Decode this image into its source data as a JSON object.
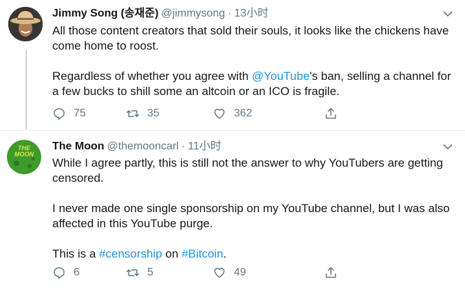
{
  "tweets": [
    {
      "author_name": "Jimmy Song (송재준)",
      "handle": "@jimmysong",
      "separator": "·",
      "time": "13小时",
      "text_p1": "All those content creators that sold their souls, it looks like the chickens have come home to roost.",
      "text_p2_before": "Regardless of whether you agree with ",
      "text_p2_mention": "@YouTube",
      "text_p2_after": "'s ban, selling a channel for a few bucks to shill some an altcoin or an ICO is fragile.",
      "replies": "75",
      "retweets": "35",
      "likes": "362",
      "avatar_icon": "cowboy-hat-avatar-icon"
    },
    {
      "author_name": "The Moon",
      "handle": "@themooncarl",
      "separator": "·",
      "time": "11小时",
      "avatar_logo_text": "THE MOON",
      "text_p1": "While I agree partly, this is still not the answer to why YouTubers are getting censored.",
      "text_p2": "I never made one single sponsorship on my YouTube channel, but I was also affected in this YouTube purge.",
      "text_p3_before": "This is a ",
      "text_p3_hashtag1": "#censorship",
      "text_p3_mid": " on ",
      "text_p3_hashtag2": "#Bitcoin",
      "text_p3_after": ".",
      "replies": "6",
      "retweets": "5",
      "likes": "49",
      "avatar_icon": "moon-logo-avatar-icon"
    }
  ],
  "colors": {
    "text": "#14171a",
    "secondary": "#657786",
    "link": "#1b95e0",
    "divider": "#e6ecf0",
    "thread_line": "#ccd6dd",
    "moon_green": "#3f9a2c"
  },
  "icons": [
    "chevron-down-icon",
    "reply-icon",
    "retweet-icon",
    "like-icon",
    "share-icon"
  ]
}
